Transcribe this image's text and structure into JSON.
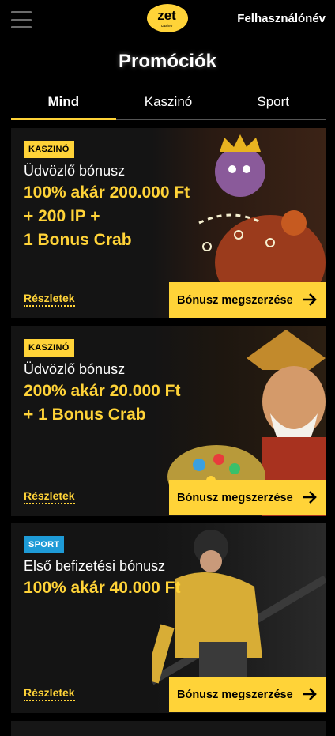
{
  "header": {
    "logo_text": "zet",
    "logo_subtext": "casino",
    "username": "Felhasználónév"
  },
  "page_title": "Promóciók",
  "tabs": [
    {
      "label": "Mind",
      "active": true
    },
    {
      "label": "Kaszinó",
      "active": false
    },
    {
      "label": "Sport",
      "active": false
    }
  ],
  "promotions": [
    {
      "badge": "KASZINÓ",
      "title": "Üdvözlő bónusz",
      "lines": [
        "100% akár 200.000 Ft",
        "+ 200 IP +",
        "1 Bonus Crab"
      ],
      "details_label": "Részletek",
      "cta_label": "Bónusz megszerzése"
    },
    {
      "badge": "KASZINÓ",
      "title": "Üdvözlő bónusz",
      "lines": [
        "200% akár 20.000 Ft",
        "+ 1 Bonus Crab"
      ],
      "details_label": "Részletek",
      "cta_label": "Bónusz megszerzése"
    },
    {
      "badge": "SPORT",
      "title": "Első befizetési bónusz",
      "lines": [
        "100% akár 40.000 Ft"
      ],
      "details_label": "Részletek",
      "cta_label": "Bónusz megszerzése"
    }
  ],
  "colors": {
    "accent": "#ffd338",
    "sport_badge": "#1e9bd7",
    "card_bg": "#141414",
    "page_bg": "#000000"
  },
  "icons": {
    "menu": "hamburger-icon",
    "cta": "arrow-right-icon"
  }
}
